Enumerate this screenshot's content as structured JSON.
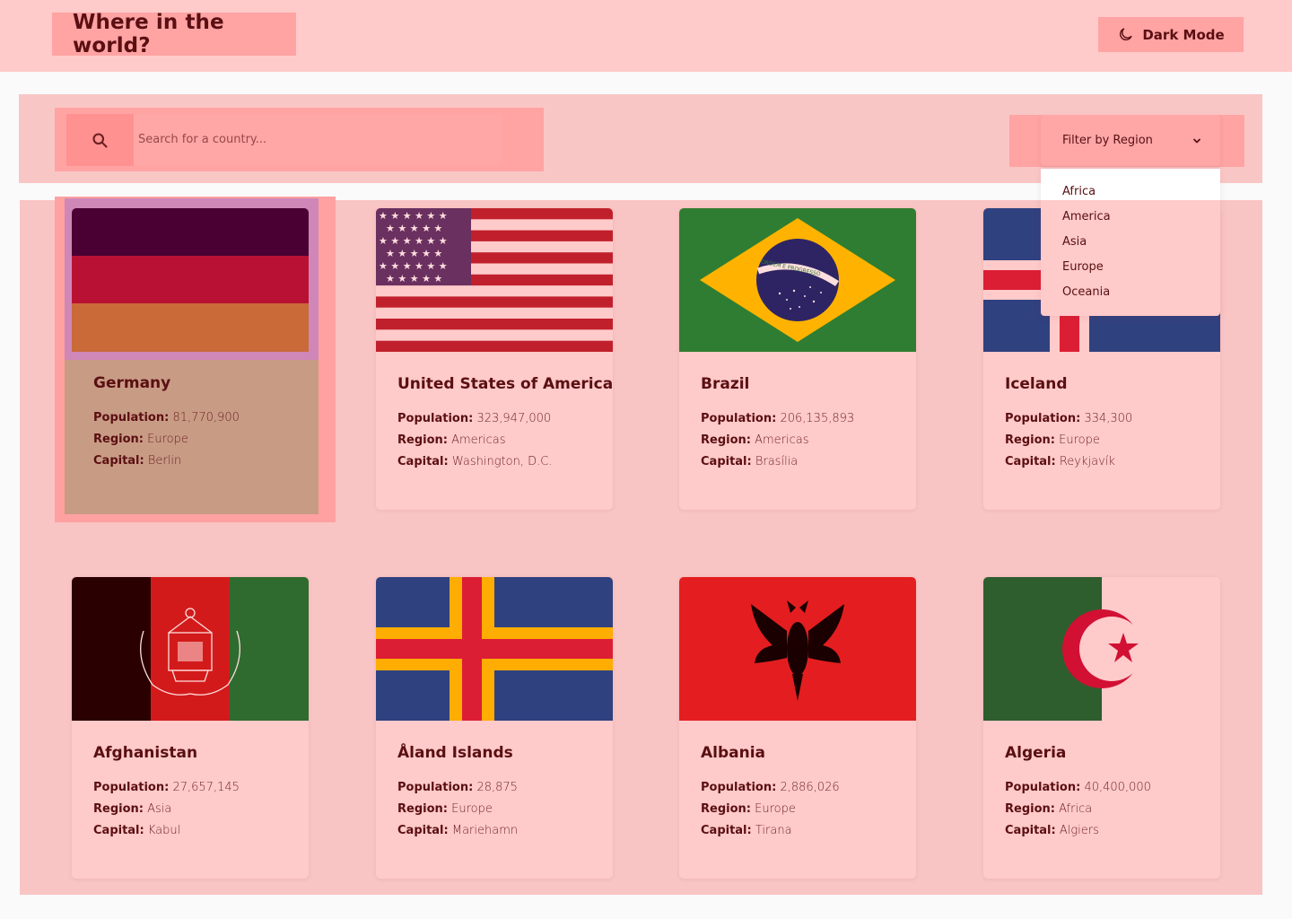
{
  "header": {
    "title": "Where in the world?",
    "dark_mode_label": "Dark Mode"
  },
  "search": {
    "placeholder": "Search for a country..."
  },
  "filter": {
    "label": "Filter by Region",
    "options": [
      "Africa",
      "America",
      "Asia",
      "Europe",
      "Oceania"
    ]
  },
  "labels": {
    "population": "Population:",
    "region": "Region:",
    "capital": "Capital:"
  },
  "countries": [
    {
      "name": "Germany",
      "population": "81,770,900",
      "region": "Europe",
      "capital": "Berlin"
    },
    {
      "name": "United States of America",
      "population": "323,947,000",
      "region": "Americas",
      "capital": "Washington, D.C."
    },
    {
      "name": "Brazil",
      "population": "206,135,893",
      "region": "Americas",
      "capital": "Brasília"
    },
    {
      "name": "Iceland",
      "population": "334,300",
      "region": "Europe",
      "capital": "Reykjavík"
    },
    {
      "name": "Afghanistan",
      "population": "27,657,145",
      "region": "Asia",
      "capital": "Kabul"
    },
    {
      "name": "Åland Islands",
      "population": "28,875",
      "region": "Europe",
      "capital": "Mariehamn"
    },
    {
      "name": "Albania",
      "population": "2,886,026",
      "region": "Europe",
      "capital": "Tirana"
    },
    {
      "name": "Algeria",
      "population": "40,400,000",
      "region": "Africa",
      "capital": "Algiers"
    }
  ],
  "flag_text": {
    "brazil_motto": "ORDEM E PROGRESSO"
  },
  "colors": {
    "header_bg": "#ffcaca",
    "accent": "#ffa3a3",
    "text": "#5a0f12"
  }
}
